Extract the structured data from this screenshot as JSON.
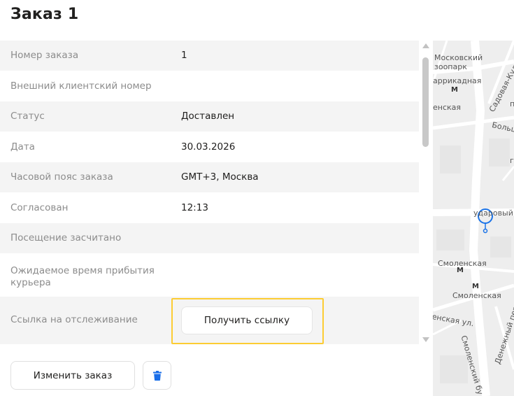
{
  "page": {
    "title": "Заказ 1"
  },
  "rows": [
    {
      "label": "Номер заказа",
      "value": "1"
    },
    {
      "label": "Внешний клиентский номер",
      "value": ""
    },
    {
      "label": "Статус",
      "value": "Доставлен"
    },
    {
      "label": "Дата",
      "value": "30.03.2026"
    },
    {
      "label": "Часовой пояс заказа",
      "value": "GMT+3, Москва"
    },
    {
      "label": "Согласован",
      "value": "12:13"
    },
    {
      "label": "Посещение засчитано",
      "value": ""
    },
    {
      "label": "Ожидаемое время прибытия курьера",
      "value": ""
    },
    {
      "label": "Ссылка на отслеживание",
      "value": ""
    }
  ],
  "tracking": {
    "button_label": "Получить ссылку"
  },
  "actions": {
    "edit_label": "Изменить заказ",
    "delete_icon": "trash-icon"
  },
  "map": {
    "labels": {
      "zoo_1": "Московский",
      "zoo_2": "зоопарк",
      "barrikadnaya": "аррикадная",
      "presnenskaya": "енская",
      "sadovaya": "Садовая-Кудрин",
      "p_street": "п",
      "bolsh": "Больш",
      "g_street": "г",
      "udarny": "ударовый",
      "smolenskaya_top": "Смоленская",
      "smolenskaya_bottom": "Смоленская",
      "smolenskaya_ul": "енская ул.",
      "denezhny": "Денежный пер",
      "smolensky_bul": "Смоленский бу"
    },
    "metro_symbol": "М",
    "pin_color": "#1a73e8",
    "road_color": "#ffffff"
  },
  "colors": {
    "highlight": "#fccc33",
    "delete_icon": "#1a6ee8",
    "row_odd": "#f4f4f4"
  }
}
